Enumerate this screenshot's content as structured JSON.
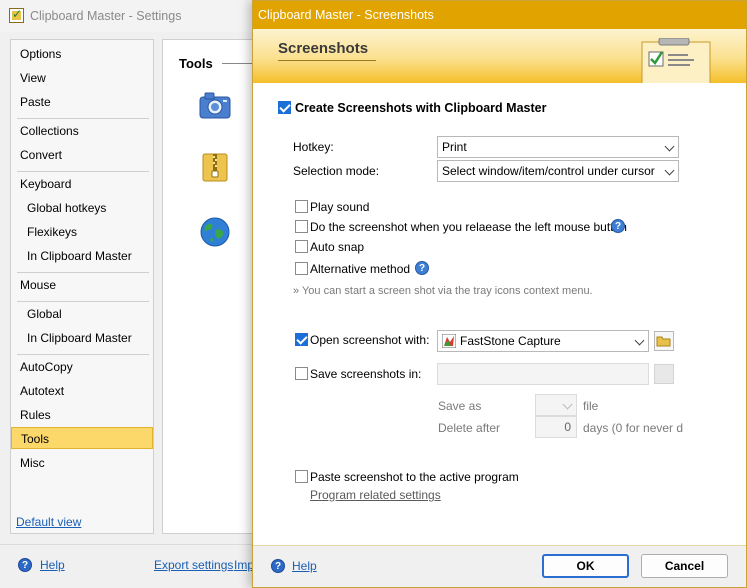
{
  "back_window": {
    "title": "Clipboard Master - Settings",
    "nav": [
      {
        "label": "Options",
        "sub": false
      },
      {
        "label": "View",
        "sub": false
      },
      {
        "label": "Paste",
        "sub": false
      },
      {
        "label": "Collections",
        "sub": false
      },
      {
        "label": "Convert",
        "sub": false
      },
      {
        "label": "Keyboard",
        "sub": false
      },
      {
        "label": "Global hotkeys",
        "sub": true
      },
      {
        "label": "Flexikeys",
        "sub": true
      },
      {
        "label": "In Clipboard Master",
        "sub": true
      },
      {
        "label": "Mouse",
        "sub": false
      },
      {
        "label": "Global",
        "sub": true
      },
      {
        "label": "In Clipboard Master",
        "sub": true
      },
      {
        "label": "AutoCopy",
        "sub": false
      },
      {
        "label": "Autotext",
        "sub": false
      },
      {
        "label": "Rules",
        "sub": false
      },
      {
        "label": "Tools",
        "sub": false,
        "selected": true
      },
      {
        "label": "Misc",
        "sub": false
      }
    ],
    "default_view": "Default view",
    "tools_title": "Tools",
    "help": "Help",
    "export_settings": "Export settings",
    "import_settings": "Imp"
  },
  "dialog": {
    "title": "Clipboard Master - Screenshots",
    "banner_title": "Screenshots",
    "create_label": "Create Screenshots with Clipboard Master",
    "create_checked": true,
    "hotkey_label": "Hotkey:",
    "hotkey_value": "Print",
    "selection_label": "Selection mode:",
    "selection_value": "Select window/item/control under cursor",
    "play_sound": "Play sound",
    "on_release": "Do the screenshot when you relaease the left mouse button",
    "auto_snap": "Auto snap",
    "alt_method": "Alternative method",
    "tray_hint": "» You can start a screen shot via the tray icons context menu.",
    "open_with_label": "Open screenshot with:",
    "open_with_checked": true,
    "open_with_value": "FastStone Capture",
    "save_in_label": "Save screenshots in:",
    "save_as_label": "Save as",
    "save_as_suffix": "file",
    "delete_after_label": "Delete after",
    "delete_after_value": "0",
    "delete_after_suffix": "days (0 for never d",
    "paste_active_label": "Paste screenshot to the active program",
    "program_settings_link": "Program related settings",
    "help": "Help",
    "ok": "OK",
    "cancel": "Cancel"
  },
  "colors": {
    "accent": "#e1a300",
    "selection": "#fcd86a",
    "link": "#1a5fb4",
    "checkbox_on": "#1d6fd8"
  }
}
